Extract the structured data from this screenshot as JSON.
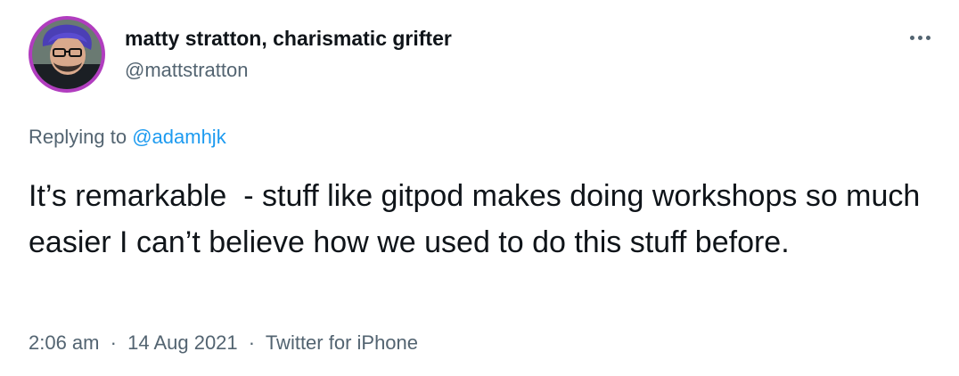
{
  "author": {
    "display_name": "matty stratton, charismatic grifter",
    "handle": "@mattstratton",
    "avatar_icon": "profile-photo",
    "avatar_ring_color": "#b13dbf"
  },
  "menu": {
    "icon": "more-horizontal-icon"
  },
  "reply": {
    "prefix": "Replying to",
    "mention": "@adamhjk"
  },
  "tweet": {
    "text": "It’s remarkable  - stuff like gitpod makes doing workshops so much easier I can’t believe how we used to do this stuff before."
  },
  "meta": {
    "time": "2:06 am",
    "date": "14 Aug 2021",
    "source": "Twitter for iPhone",
    "separator": "·"
  },
  "colors": {
    "text": "#0f1419",
    "secondary": "#536471",
    "link": "#1d9bf0"
  }
}
